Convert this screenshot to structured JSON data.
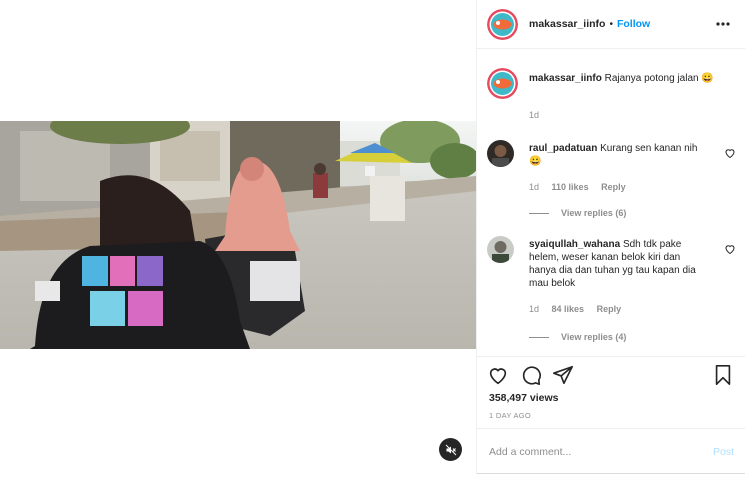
{
  "post": {
    "username": "makassar_iinfo",
    "dot": "•",
    "follow_label": "Follow",
    "more_icon": "more-horizontal-icon",
    "mute_icon": "speaker-muted-icon"
  },
  "caption": {
    "username": "makassar_iinfo",
    "text": "Rajanya potong jalan 😀",
    "time": "1d"
  },
  "comments": [
    {
      "username": "raul_padatuan",
      "text": "Kurang sen kanan nih😀",
      "time": "1d",
      "likes": "110 likes",
      "reply_label": "Reply",
      "view_replies": "View replies (6)"
    },
    {
      "username": "syaiqullah_wahana",
      "text": "Sdh tdk pake helem, weser kanan belok kiri dan hanya dia dan tuhan yg tau kapan dia mau belok",
      "time": "1d",
      "likes": "84 likes",
      "reply_label": "Reply",
      "view_replies": "View replies (4)"
    }
  ],
  "stats": {
    "views": "358,497 views",
    "date": "1 DAY AGO"
  },
  "composer": {
    "placeholder": "Add a comment...",
    "post_label": "Post"
  },
  "colors": {
    "accent": "#0095f6",
    "post_disabled": "#b2dffc",
    "secondary_text": "#8e8e8e"
  }
}
